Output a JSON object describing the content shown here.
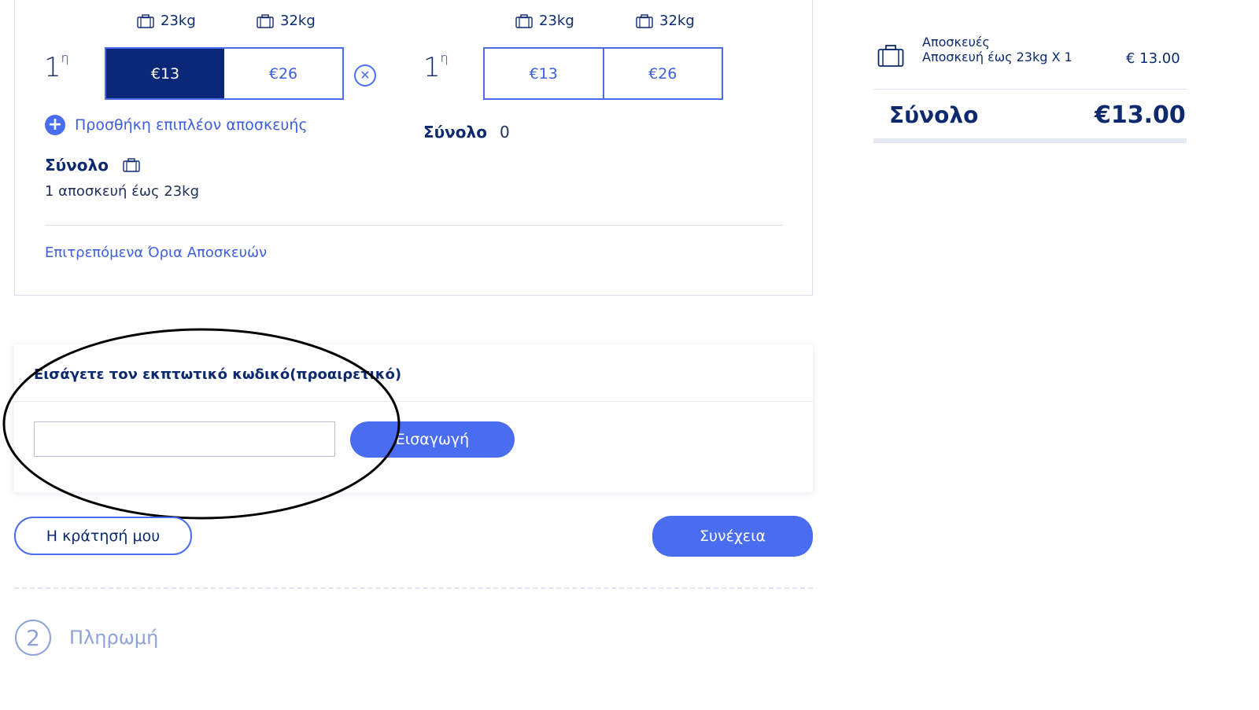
{
  "baggage": {
    "passenger1": {
      "weights": [
        {
          "label": "23kg"
        },
        {
          "label": "32kg"
        }
      ],
      "ordinal": "1",
      "ordinal_sup": "η",
      "options": [
        {
          "price": "€13",
          "selected": true
        },
        {
          "price": "€26",
          "selected": false
        }
      ],
      "remove_icon": "✕",
      "add_more": "Προσθήκη επιπλέον αποσκευής",
      "total_label": "Σύνολο",
      "total_summary": "1 αποσκευή έως 23kg"
    },
    "passenger2": {
      "weights": [
        {
          "label": "23kg"
        },
        {
          "label": "32kg"
        }
      ],
      "ordinal": "1",
      "ordinal_sup": "η",
      "options": [
        {
          "price": "€13",
          "selected": false
        },
        {
          "price": "€26",
          "selected": false
        }
      ],
      "total_label": "Σύνολο",
      "total_value": "0"
    },
    "limits_link": "Επιτρεπόμενα Όρια Αποσκευών"
  },
  "discount": {
    "title": "Εισάγετε τον εκπτωτικό κωδικό(προαιρετικό)",
    "input_value": "",
    "submit_label": "Εισαγωγή"
  },
  "actions": {
    "my_booking": "Η κράτησή μου",
    "continue": "Συνέχεια"
  },
  "next_step": {
    "number": "2",
    "label": "Πληρωμή"
  },
  "summary": {
    "category": "Αποσκευές",
    "item": "Αποσκευή έως 23kg X 1",
    "item_price": "€ 13.00",
    "total_label": "Σύνολο",
    "total_value": "€13.00"
  },
  "colors": {
    "navy": "#0b2878",
    "accent": "#4a6df0",
    "muted": "#8ea3d9"
  }
}
